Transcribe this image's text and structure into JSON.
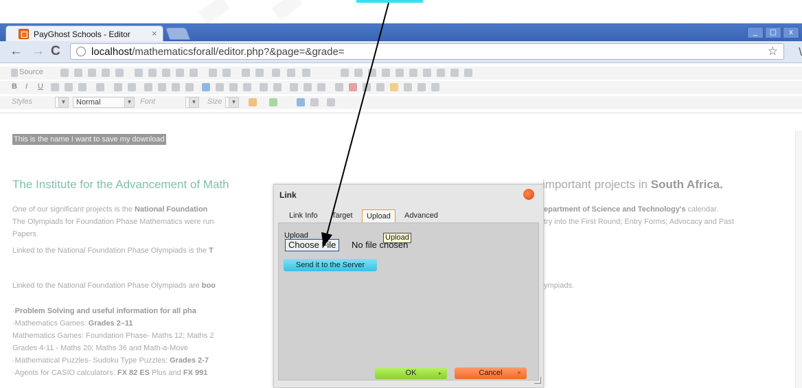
{
  "browser": {
    "tab_title": "PayGhost Schools - Editor",
    "tab_close": "×",
    "url_host": "localhost",
    "url_path": "/mathematicsforall/editor.php?&page=&grade=",
    "back": "←",
    "forward": "→",
    "reload": "C",
    "bookmark": "☆",
    "wrench": "\\",
    "win_min": "_",
    "win_max": "▢",
    "win_close": "x"
  },
  "toolbar": {
    "source": "Source",
    "styles": "Styles",
    "format": "Normal",
    "font": "Font",
    "size": "Size"
  },
  "editor": {
    "selected_text": "This is the name I want to save my download",
    "heading_left": "The Institute for the Advancement of Math",
    "heading_right_pre": "important projects in ",
    "heading_right_bold": "South Africa.",
    "lines": [
      {
        "left_pre": "One of our significant projects is the ",
        "left_bold": "National Foundation",
        "right_bold": "epartment of Science and Technology's",
        "right_post": " calendar."
      },
      {
        "left_pre": "The Olympiads for Foundation Phase Mathematics were run",
        "left_bold": "",
        "right_bold": "",
        "right_post": "try into the First Round; Entry Forms; Advocacy and Past"
      },
      {
        "left_pre": "Papers.",
        "left_bold": "",
        "right_bold": "",
        "right_post": ""
      },
      {
        "left_pre": "Linked to the National Foundation Phase Olympiads is the ",
        "left_bold": "T",
        "right_bold": "",
        "right_post": ""
      },
      {
        "left_pre": "Linked to the National Foundation Phase Olympiads are ",
        "left_bold": "boo",
        "right_bold": "",
        "right_post": "ympiads."
      },
      {
        "left_pre": ".",
        "left_bold": "",
        "right_bold": "",
        "right_post": ""
      },
      {
        "left_pre": "·",
        "left_bold": "Problem Solving and useful information for all pha",
        "right_bold": "",
        "right_post": ""
      },
      {
        "left_pre": "·Mathematics Games: ",
        "left_bold": "Grades 2–11",
        "right_bold": "",
        "right_post": ""
      },
      {
        "left_pre": "Mathematics Games: Foundation Phase- Maths 12; Maths 2",
        "left_bold": "",
        "right_bold": "",
        "right_post": ""
      },
      {
        "left_pre": "Grades 4-11 - Maths 20; Maths 36 and Math-a-Move",
        "left_bold": "",
        "right_bold": "",
        "right_post": ""
      },
      {
        "left_pre": "·Mathematical Puzzles- Sudoku Type Puzzles: ",
        "left_bold": "Grades 2-7",
        "right_bold": "",
        "right_post": ""
      },
      {
        "left_pre": "·Agents for CASIO calculators: ",
        "left_bold": "FX 82 ES",
        "right_bold": "",
        "right_post": ""
      }
    ],
    "last_line_rest_pre": " Plus and ",
    "last_line_rest_bold": "FX 991"
  },
  "dialog": {
    "title": "Link",
    "tabs": [
      "Link Info",
      "Target",
      "Upload",
      "Advanced"
    ],
    "active_tab": "Upload",
    "upload_label": "Upload",
    "choose_file": "Choose File",
    "no_file": "No file chosen",
    "tooltip": "Upload",
    "send_button": "Send it to the Server",
    "ok_button": "OK",
    "cancel_button": "Cancel",
    "ok_arrow": "▸",
    "cancel_x": "×"
  },
  "colors": {
    "heading": "#7ec1ae",
    "tab_active_border": "#d9a23a",
    "send_button": "#35c4e6",
    "ok_button": "#8bd22a",
    "cancel_button": "#f26a28",
    "annotation_highlight": "#35e0f5"
  }
}
